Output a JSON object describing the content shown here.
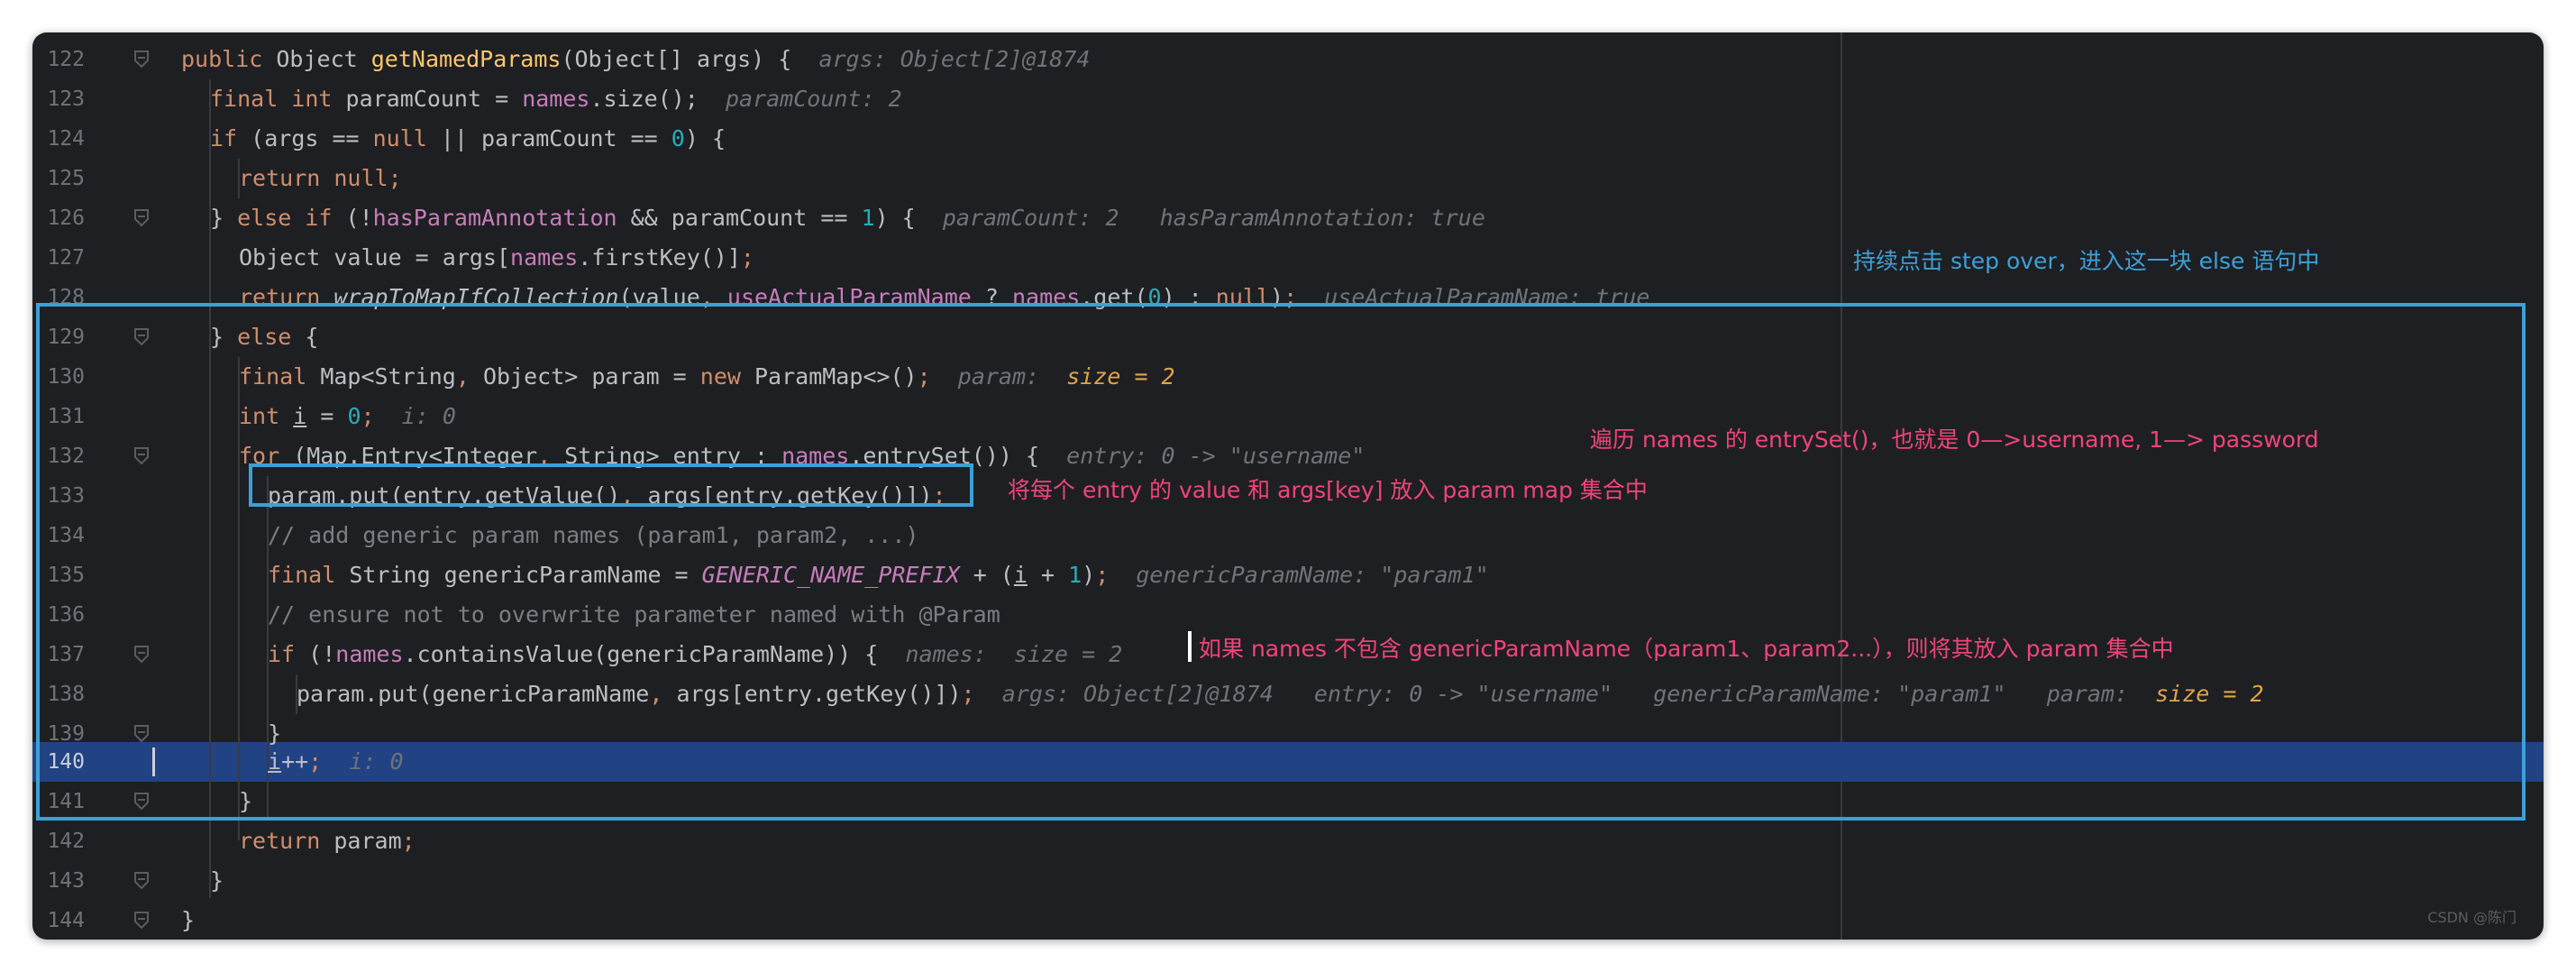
{
  "editor": {
    "lines": [
      {
        "num": "122",
        "fold": true
      },
      {
        "num": "123",
        "fold": false
      },
      {
        "num": "124",
        "fold": false
      },
      {
        "num": "125",
        "fold": false
      },
      {
        "num": "126",
        "fold": true
      },
      {
        "num": "127",
        "fold": false
      },
      {
        "num": "128",
        "fold": false
      },
      {
        "num": "129",
        "fold": true
      },
      {
        "num": "130",
        "fold": false
      },
      {
        "num": "131",
        "fold": false
      },
      {
        "num": "132",
        "fold": true
      },
      {
        "num": "133",
        "fold": false
      },
      {
        "num": "134",
        "fold": false
      },
      {
        "num": "135",
        "fold": false
      },
      {
        "num": "136",
        "fold": false
      },
      {
        "num": "137",
        "fold": true
      },
      {
        "num": "138",
        "fold": false
      },
      {
        "num": "139",
        "fold": true
      },
      {
        "num": "140",
        "fold": false
      },
      {
        "num": "141",
        "fold": true
      },
      {
        "num": "142",
        "fold": false
      },
      {
        "num": "143",
        "fold": true
      },
      {
        "num": "144",
        "fold": true
      }
    ],
    "highlighted_line": "140",
    "hints": {
      "l122": "args: Object[2]@1874",
      "l123": "paramCount: 2",
      "l126a": "paramCount: 2",
      "l126b": "hasParamAnnotation: true",
      "l128": "useActualParamName: true",
      "l130a": "param:",
      "l130b": "size = 2",
      "l131": "i: 0",
      "l132": "entry: 0 -> \"username\"",
      "l135": "genericParamName: \"param1\"",
      "l137a": "names:",
      "l137b": "size = 2",
      "l138a": "args: Object[2]@1874",
      "l138b": "entry: 0 -> \"username\"",
      "l138c": "genericParamName: \"param1\"",
      "l138d": "param:",
      "l138e": "size = 2",
      "l140": "i: 0"
    }
  },
  "annotations": {
    "step_over": "持续点击 step over，进入这一块 else 语句中",
    "entry_set": "遍历 names 的 entrySet()，也就是 0—>username, 1—> password",
    "put_map": "将每个 entry 的 value 和 args[key] 放入 param map 集合中",
    "contains": "如果 names 不包含 genericParamName（param1、param2...），则将其放入 param 集合中"
  },
  "watermark": "CSDN @陈门"
}
